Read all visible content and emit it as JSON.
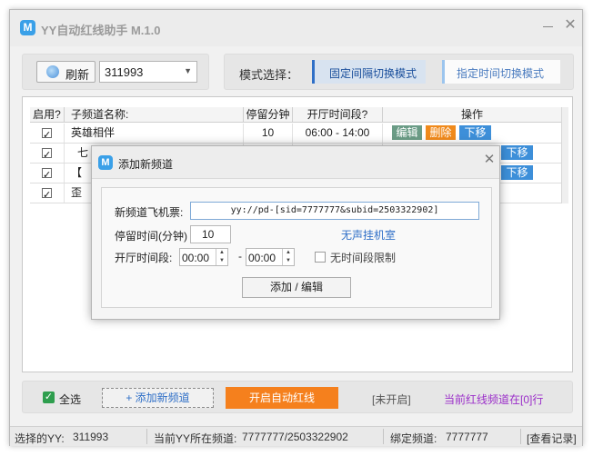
{
  "window": {
    "title": "YY自动红线助手 M.1.0",
    "icon_letter": "M",
    "minimize_label": "",
    "close_glyph": "✕"
  },
  "top": {
    "refresh_label": "刷新",
    "yy_selected": "311993",
    "mode_label": "模式选择：",
    "mode_fixed_interval": "固定间隔切换模式",
    "mode_scheduled": "指定时间切换模式"
  },
  "table": {
    "headers": [
      "启用?",
      "子频道名称:",
      "停留分钟",
      "开厅时间段?",
      "操作"
    ],
    "rows": [
      {
        "name": "英雄相伴",
        "stay": "10",
        "time": "06:00 - 14:00",
        "enabled": true
      },
      {
        "name": "七",
        "stay": "",
        "time": "",
        "enabled": true
      },
      {
        "name": "【",
        "stay": "",
        "time": "",
        "enabled": true
      },
      {
        "name": "歪",
        "stay": "",
        "time": "",
        "enabled": true
      }
    ],
    "op_edit": "编辑",
    "op_delete": "删除",
    "op_down": "下移"
  },
  "bottom": {
    "select_all": "全选",
    "add_channel": "+ 添加新频道",
    "start": "开启自动红线",
    "status": "[未开启]",
    "current_row": "当前红线频道在[0]行"
  },
  "status_bar": {
    "selected_yy_label": "选择的YY:",
    "selected_yy_value": "311993",
    "current_channel_label": "当前YY所在频道:",
    "current_channel_value": "7777777/2503322902",
    "bound_channel_label": "绑定频道:",
    "bound_channel_value": "7777777",
    "view_log": "[查看记录]"
  },
  "dialog": {
    "title": "添加新频道",
    "close_glyph": "✕",
    "ticket_label": "新频道飞机票:",
    "ticket_value": "yy://pd-[sid=7777777&subid=2503322902]",
    "stay_label": "停留时间(分钟)",
    "stay_value": "10",
    "silent_link": "无声挂机室",
    "time_label": "开厅时间段:",
    "time_start": "00:00",
    "time_end": "00:00",
    "time_dash": "-",
    "no_limit_label": "无时间段限制",
    "submit": "添加 / 编辑"
  },
  "colors": {
    "accent_blue": "#2f6fc7",
    "start_orange": "#f5801d",
    "delete_orange": "#f08a1c",
    "edit_green": "#6b9c86",
    "down_blue": "#3d8fd9",
    "purple_text": "#9b2ec9",
    "select_all_green": "#2e9e4e"
  },
  "icons": {
    "app": "app-logo-icon",
    "refresh": "refresh-icon",
    "dropdown": "chevron-down-icon",
    "close": "close-icon"
  }
}
